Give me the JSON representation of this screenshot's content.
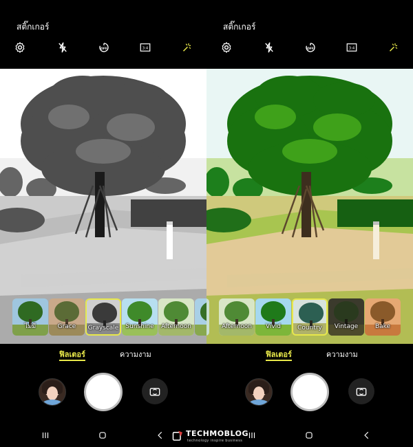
{
  "watermark": {
    "brand": "TECHMOBLOG",
    "tagline": "technology inspire business"
  },
  "colors": {
    "accent": "#e8e84a",
    "background": "#000000"
  },
  "panels": [
    {
      "title": "สติ๊กเกอร์",
      "toolbar": [
        {
          "icon": "gear-icon"
        },
        {
          "icon": "flash-off-icon"
        },
        {
          "icon": "timer-off-icon",
          "label": "OFF"
        },
        {
          "icon": "aspect-ratio-icon",
          "label": "3:4"
        },
        {
          "icon": "magic-wand-icon"
        }
      ],
      "filters": [
        {
          "label": "ไม่มี",
          "selected": false
        },
        {
          "label": "Grace",
          "selected": false
        },
        {
          "label": "Grayscale",
          "selected": true
        },
        {
          "label": "Sunshine",
          "selected": false
        },
        {
          "label": "Afternoon",
          "selected": false
        }
      ],
      "tabs": {
        "filter": "ฟิลเตอร์",
        "beauty": "ความงาม"
      }
    },
    {
      "title": "สติ๊กเกอร์",
      "toolbar": [
        {
          "icon": "gear-icon"
        },
        {
          "icon": "flash-off-icon"
        },
        {
          "icon": "timer-off-icon",
          "label": "OFF"
        },
        {
          "icon": "aspect-ratio-icon",
          "label": "3:4"
        },
        {
          "icon": "magic-wand-icon"
        }
      ],
      "filters": [
        {
          "label": "Afternoon",
          "selected": false
        },
        {
          "label": "Vivid",
          "selected": false
        },
        {
          "label": "Country",
          "selected": true
        },
        {
          "label": "Vintage",
          "selected": false
        },
        {
          "label": "Bake",
          "selected": false
        }
      ],
      "tabs": {
        "filter": "ฟิลเตอร์",
        "beauty": "ความงาม"
      }
    }
  ]
}
